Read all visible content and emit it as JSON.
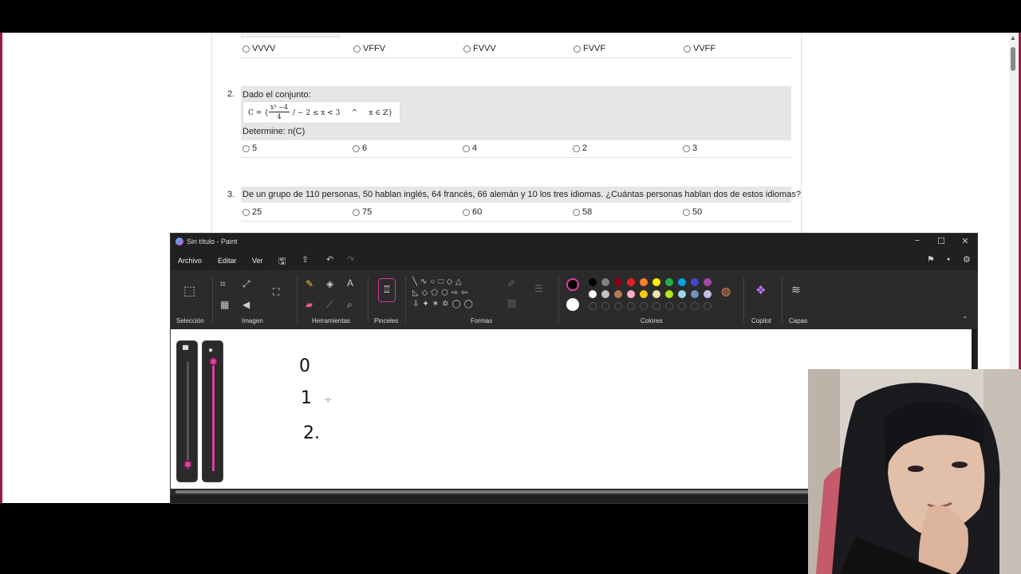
{
  "quiz": {
    "q1_options": [
      "VVVV",
      "VFFV",
      "FVVV",
      "FVVF",
      "VVFF"
    ],
    "q2": {
      "number": "2.",
      "prompt": "Dado el conjunto:",
      "formula_prefix": "C = {",
      "formula_num": "x² −4",
      "formula_den": "4",
      "formula_suffix": "/ − 2 ≤ x < 3     ^     x ∈ ℤ}",
      "footer": "Determine: n(C)",
      "options": [
        "5",
        "6",
        "4",
        "2",
        "3"
      ]
    },
    "q3": {
      "number": "3.",
      "prompt": "De un grupo de 110 personas, 50 hablan inglés, 64 francés, 66 alemán y 10 los tres idiomas. ¿Cuántas personas hablan dos de estos idiomas?",
      "options": [
        "25",
        "75",
        "60",
        "58",
        "50"
      ]
    }
  },
  "paint": {
    "title": "Sin título - Paint",
    "window_controls": {
      "minimize": "−",
      "maximize": "☐",
      "close": "✕"
    },
    "menu": [
      "Archivo",
      "Editar",
      "Ver"
    ],
    "groups": [
      "Selección",
      "Imagen",
      "Herramientas",
      "Pinceles",
      "Formas",
      "Colores",
      "Copilot",
      "Capas"
    ],
    "colors_row1": [
      "#000000",
      "#7f7f7f",
      "#880015",
      "#ed1c24",
      "#ff7f27",
      "#fff200",
      "#22b14c",
      "#00a2e8",
      "#3f48cc",
      "#a349a4"
    ],
    "colors_row2": [
      "#ffffff",
      "#c3c3c3",
      "#b97a57",
      "#ffaec9",
      "#ffc90e",
      "#efe4b0",
      "#b5e61d",
      "#99d9ea",
      "#7092be",
      "#c8bfe7"
    ],
    "color1": "#000000",
    "color2": "#ffffff",
    "accent": "#e040a0",
    "canvas_marks": [
      "0",
      "1",
      "2."
    ]
  }
}
